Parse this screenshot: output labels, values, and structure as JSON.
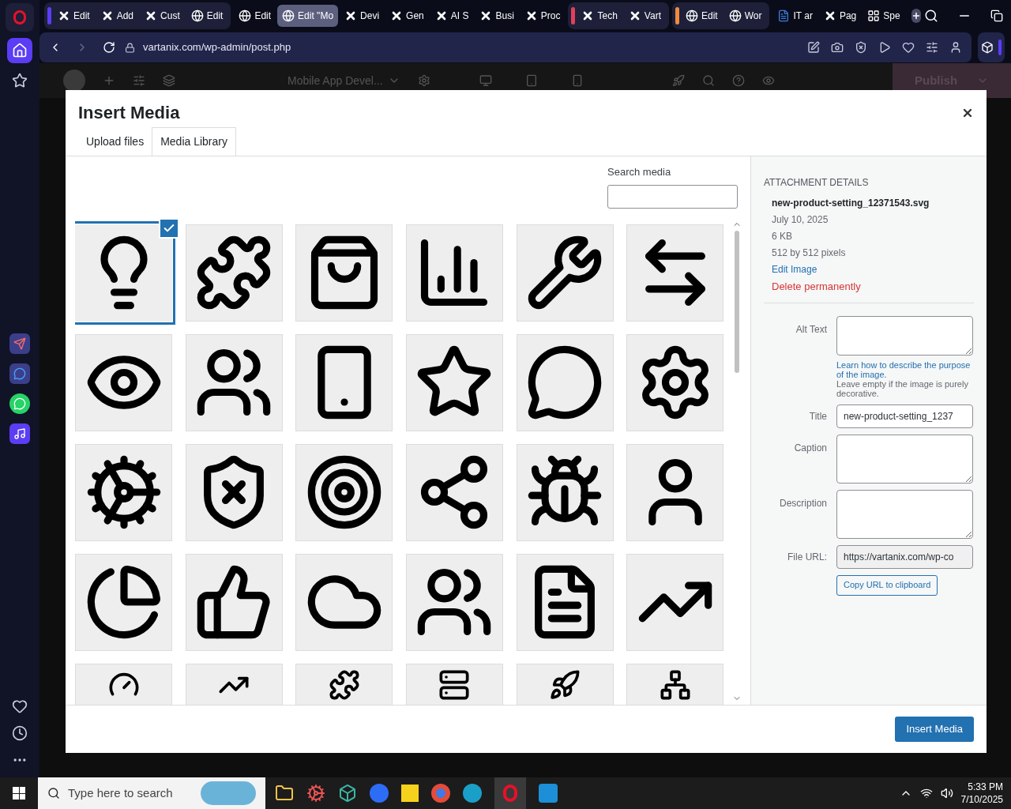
{
  "tab_strip": [
    {
      "kind": "group",
      "color": "#5b3df5",
      "tabs": [
        {
          "label": "Edit",
          "kind": "cross",
          "selected": false
        },
        {
          "label": "Add",
          "kind": "cross",
          "selected": false
        },
        {
          "label": "Cust",
          "kind": "cross",
          "selected": false
        },
        {
          "label": "Edit",
          "kind": "globe",
          "selected": false
        }
      ]
    },
    {
      "kind": "loose",
      "tabs": [
        {
          "label": "Edit",
          "kind": "globe",
          "selected": false
        },
        {
          "label": "Edit \"Mo",
          "kind": "globe",
          "selected": true
        },
        {
          "label": "Devi",
          "kind": "cross",
          "selected": false
        },
        {
          "label": "Gen",
          "kind": "cross",
          "selected": false
        },
        {
          "label": "AI S",
          "kind": "cross",
          "selected": false
        },
        {
          "label": "Busi",
          "kind": "cross",
          "selected": false
        },
        {
          "label": "Proc",
          "kind": "cross",
          "selected": false
        }
      ]
    },
    {
      "kind": "group",
      "color": "#e0405a",
      "tabs": [
        {
          "label": "Tech",
          "kind": "cross",
          "selected": false
        },
        {
          "label": "Vart",
          "kind": "cross",
          "selected": false
        }
      ]
    },
    {
      "kind": "group",
      "color": "#f08a40",
      "tabs": [
        {
          "label": "Edit",
          "kind": "globe",
          "selected": false
        },
        {
          "label": "Wor",
          "kind": "globe",
          "selected": false
        }
      ]
    },
    {
      "kind": "loose",
      "tabs": [
        {
          "label": "IT ar",
          "kind": "doc",
          "selected": false
        },
        {
          "label": "Pag",
          "kind": "cross",
          "selected": false
        },
        {
          "label": "Spe",
          "kind": "grid",
          "selected": false
        }
      ]
    }
  ],
  "address_bar": {
    "url": "vartanix.com/wp-admin/post.php"
  },
  "editor_header": {
    "page_title": "Mobile App Devel...",
    "publish": "Publish"
  },
  "modal": {
    "title": "Insert Media",
    "tabs": [
      {
        "label": "Upload files",
        "selected": false
      },
      {
        "label": "Media Library",
        "selected": true
      }
    ],
    "search_label": "Search media",
    "media": [
      {
        "selected": true
      },
      {
        "selected": false
      },
      {
        "selected": false
      },
      {
        "selected": false
      },
      {
        "selected": false
      },
      {
        "selected": false
      },
      {
        "selected": false
      },
      {
        "selected": false
      },
      {
        "selected": false
      },
      {
        "selected": false
      },
      {
        "selected": false
      },
      {
        "selected": false
      },
      {
        "selected": false
      },
      {
        "selected": false
      },
      {
        "selected": false
      },
      {
        "selected": false
      },
      {
        "selected": false
      },
      {
        "selected": false
      },
      {
        "selected": false
      },
      {
        "selected": false
      },
      {
        "selected": false
      },
      {
        "selected": false
      },
      {
        "selected": false
      },
      {
        "selected": false
      },
      {
        "selected": false
      },
      {
        "selected": false
      },
      {
        "selected": false
      },
      {
        "selected": false
      },
      {
        "selected": false
      },
      {
        "selected": false
      }
    ],
    "details": {
      "heading": "ATTACHMENT DETAILS",
      "filename": "new-product-setting_12371543.svg",
      "date": "July 10, 2025",
      "size": "6 KB",
      "dimensions": "512 by 512 pixels",
      "edit_link": "Edit Image",
      "delete_link": "Delete permanently",
      "alt_label": "Alt Text",
      "alt_help_link": "Learn how to describe the purpose of the image.",
      "alt_help_rest": "Leave empty if the image is purely decorative.",
      "title_label": "Title",
      "title_value": "new-product-setting_1237",
      "caption_label": "Caption",
      "description_label": "Description",
      "url_label": "File URL:",
      "url_value": "https://vartanix.com/wp-co",
      "copy_button": "Copy URL to clipboard"
    },
    "insert_button": "Insert Media"
  },
  "taskbar": {
    "search_placeholder": "Type here to search",
    "time": "5:33 PM",
    "date": "7/10/2025"
  }
}
